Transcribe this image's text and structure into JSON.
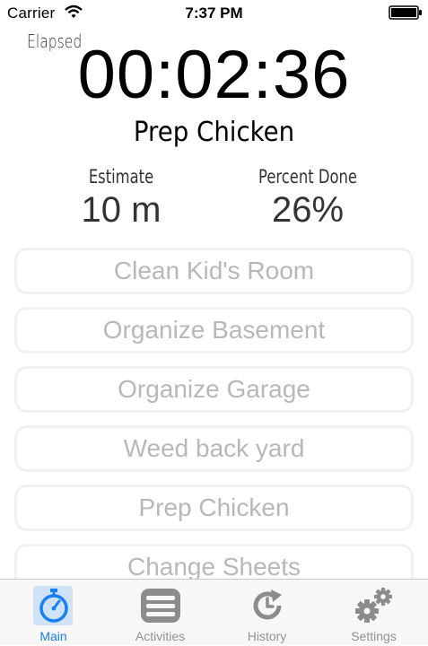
{
  "status_bar": {
    "carrier": "Carrier",
    "time": "7:37 PM"
  },
  "timer": {
    "elapsed_label": "Elapsed",
    "elapsed_value": "00:02:36",
    "current_task": "Prep Chicken"
  },
  "stats": {
    "estimate_label": "Estimate",
    "estimate_value": "10 m",
    "percent_label": "Percent Done",
    "percent_value": "26%"
  },
  "activities": [
    {
      "label": "Clean Kid's Room"
    },
    {
      "label": "Organize Basement"
    },
    {
      "label": "Organize Garage"
    },
    {
      "label": "Weed back yard"
    },
    {
      "label": "Prep Chicken"
    },
    {
      "label": "Change Sheets"
    }
  ],
  "tab_bar": {
    "tabs": [
      {
        "label": "Main",
        "icon": "stopwatch-icon",
        "active": true
      },
      {
        "label": "Activities",
        "icon": "list-icon",
        "active": false
      },
      {
        "label": "History",
        "icon": "history-icon",
        "active": false
      },
      {
        "label": "Settings",
        "icon": "gears-icon",
        "active": false
      }
    ]
  },
  "colors": {
    "accent": "#1a7ff2",
    "inactive_tab": "#929292",
    "activity_text": "#b8b8b8",
    "tab_bar_background": "#f7f7f7"
  }
}
